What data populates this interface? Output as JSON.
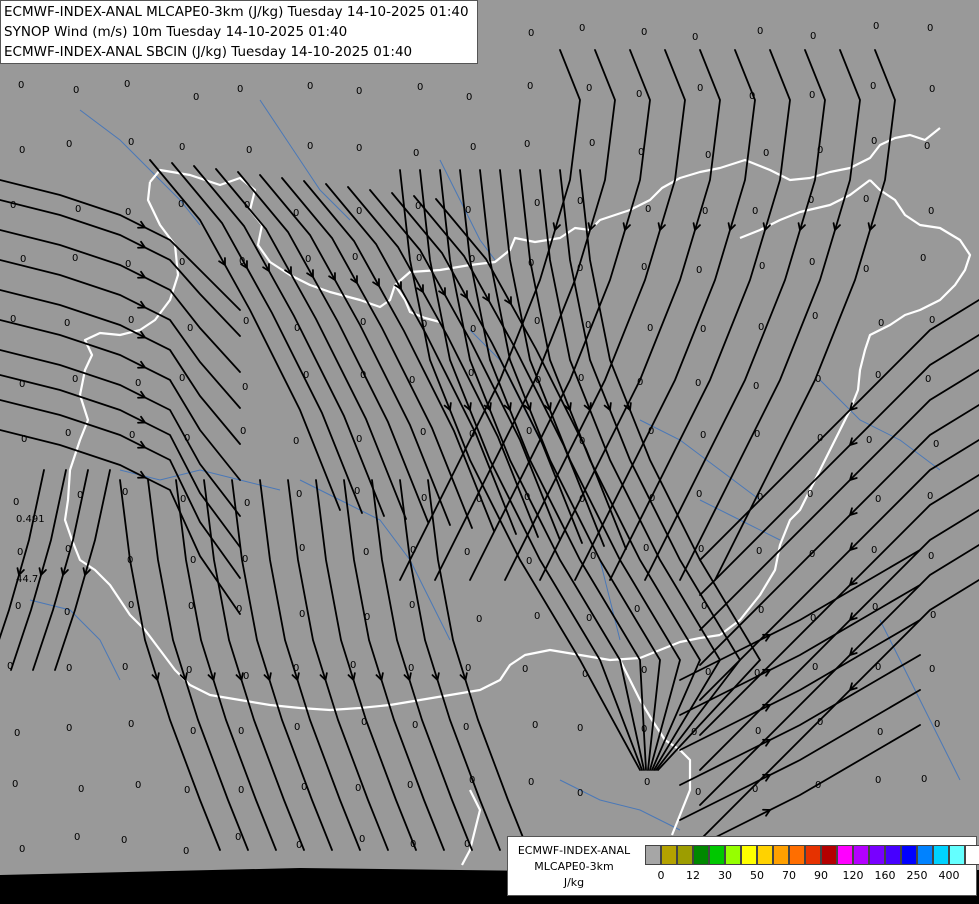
{
  "title_lines": [
    "ECMWF-INDEX-ANAL MLCAPE0-3km (J/kg) Tuesday 14-10-2025 01:40",
    "SYNOP Wind (m/s) 10m Tuesday 14-10-2025 01:40",
    "ECMWF-INDEX-ANAL SBCIN (J/kg) Tuesday 14-10-2025 01:40"
  ],
  "legend": {
    "name_lines": [
      "ECMWF-INDEX-ANAL",
      "MLCAPE0-3km",
      "J/kg"
    ],
    "colors": [
      "#a6a6a6",
      "#b4a200",
      "#9d9d00",
      "#008800",
      "#00c800",
      "#96ff00",
      "#ffff00",
      "#ffd200",
      "#ffa000",
      "#ff6e00",
      "#e63200",
      "#b40000",
      "#ff00ff",
      "#b400ff",
      "#7800ff",
      "#4600ff",
      "#0000ff",
      "#0082ff",
      "#00d2ff",
      "#64ffff",
      "#ffffff"
    ],
    "ticks": [
      {
        "label": "0",
        "i": 1
      },
      {
        "label": "12",
        "i": 3
      },
      {
        "label": "30",
        "i": 5
      },
      {
        "label": "50",
        "i": 7
      },
      {
        "label": "70",
        "i": 9
      },
      {
        "label": "90",
        "i": 11
      },
      {
        "label": "120",
        "i": 13
      },
      {
        "label": "160",
        "i": 15
      },
      {
        "label": "250",
        "i": 17
      },
      {
        "label": "400",
        "i": 19
      }
    ]
  },
  "map": {
    "background_color": "#999999",
    "border_color": "#ffffff",
    "river_color": "#4a78b8",
    "streamline_color": "#000000",
    "cin_value_labels": [
      "0.491",
      "44.7"
    ],
    "zero_label": "0"
  }
}
